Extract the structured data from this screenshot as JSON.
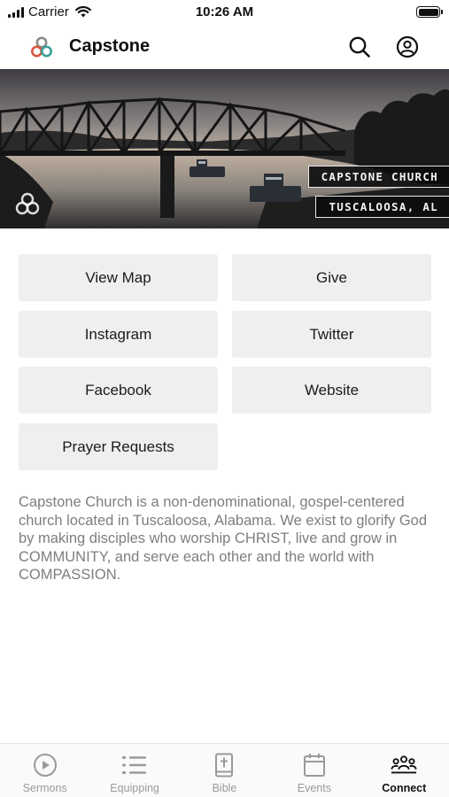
{
  "status_bar": {
    "carrier": "Carrier",
    "time": "10:26 AM"
  },
  "header": {
    "title": "Capstone",
    "icons": [
      "capstone-logo-icon",
      "search-icon",
      "account-icon"
    ]
  },
  "banner": {
    "tag_line_1": "CAPSTONE CHURCH",
    "tag_line_2": "TUSCALOOSA, AL",
    "image": "river bridge photo at sunset"
  },
  "links": [
    {
      "label": "View Map"
    },
    {
      "label": "Give"
    },
    {
      "label": "Instagram"
    },
    {
      "label": "Twitter"
    },
    {
      "label": "Facebook"
    },
    {
      "label": "Website"
    },
    {
      "label": "Prayer Requests"
    }
  ],
  "description": "Capstone Church is a non-denominational, gospel-centered church located in Tuscaloosa, Alabama. We exist to glorify God by making disciples who worship CHRIST, live and grow in COMMUNITY, and serve each other and the world with COMPASSION.",
  "tab_bar": {
    "tabs": [
      {
        "label": "Sermons",
        "icon": "play-circle-icon"
      },
      {
        "label": "Equipping",
        "icon": "list-icon"
      },
      {
        "label": "Bible",
        "icon": "bible-icon"
      },
      {
        "label": "Events",
        "icon": "calendar-icon"
      },
      {
        "label": "Connect",
        "icon": "people-icon"
      }
    ],
    "active": "Connect"
  },
  "colors": {
    "button_bg": "#eeeff1",
    "description_text": "#7e7e7e",
    "tab_inactive": "#9a9a9a",
    "tab_active": "#111111",
    "logo_red": "#d9573f",
    "logo_gray": "#8a8a8a",
    "logo_teal": "#3aa09a"
  }
}
